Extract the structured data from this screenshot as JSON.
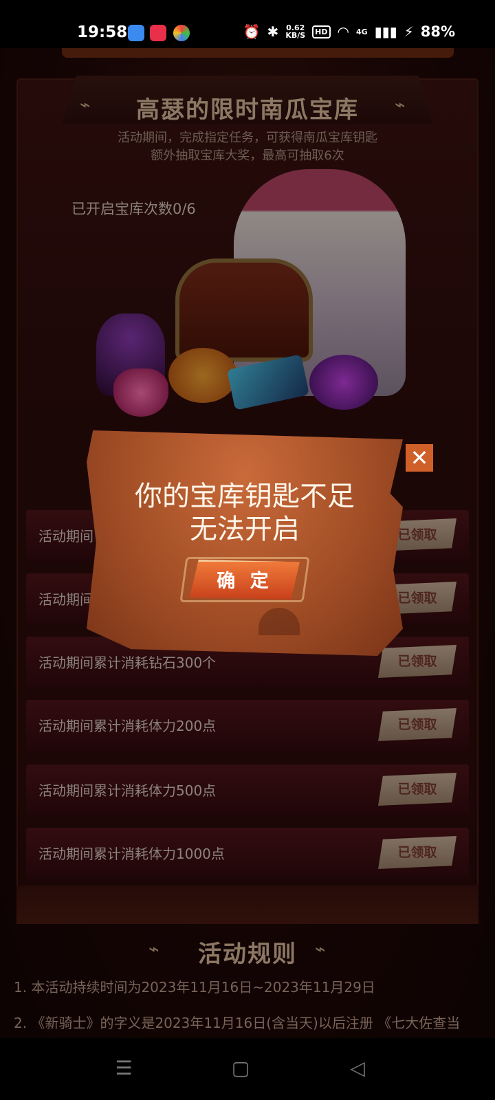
{
  "status_bar": {
    "time": "19:58",
    "net_speed_value": "0.62",
    "net_speed_unit": "KB/S",
    "hd_badge": "HD",
    "network_type": "4G",
    "battery": "88%",
    "icons": [
      "alarm-icon",
      "bluetooth-icon",
      "wifi-icon",
      "signal-icon",
      "charging-icon"
    ]
  },
  "header": {
    "title": "高瑟的限时南瓜宝库",
    "subtitle_line1": "活动期间，完成指定任务，可获得南瓜宝库钥匙",
    "subtitle_line2": "额外抽取宝库大奖，最高可抽取6次",
    "opened_count": "已开启宝库次数0/6"
  },
  "tasks": [
    {
      "label": "活动期间",
      "status": "已领取"
    },
    {
      "label": "活动期间累计",
      "status": "已领取"
    },
    {
      "label": "活动期间累计消耗钻石300个",
      "status": "已领取"
    },
    {
      "label": "活动期间累计消耗体力200点",
      "status": "已领取"
    },
    {
      "label": "活动期间累计消耗体力500点",
      "status": "已领取"
    },
    {
      "label": "活动期间累计消耗体力1000点",
      "status": "已领取"
    }
  ],
  "rules": {
    "title": "活动规则",
    "line1": "1. 本活动持续时间为2023年11月16日~2023年11月29日",
    "line2": "2. 《新骑士》的字义是2023年11月16日(含当天)以后注册 《七大佐查当"
  },
  "dialog": {
    "message_line1": "你的宝库钥匙不足",
    "message_line2": "无法开启",
    "confirm_label": "确 定",
    "close_glyph": "✕"
  },
  "colors": {
    "accent": "#d0602a",
    "dialog_bg": "#a24e26",
    "panel_bg": "#2c0c0b",
    "claimed_badge": "#c8b098"
  }
}
